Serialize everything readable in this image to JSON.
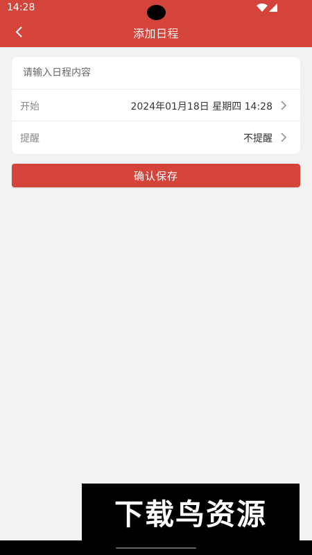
{
  "status_bar": {
    "time": "14:28",
    "icons": [
      "wifi-icon",
      "signal-icon"
    ]
  },
  "header": {
    "title": "添加日程",
    "back_icon": "chevron-left-icon",
    "bg_color": "#d4443a"
  },
  "form": {
    "content_placeholder": "请输入日程内容",
    "content_value": "",
    "start": {
      "label": "开始",
      "value": "2024年01月18日 星期四  14:28"
    },
    "reminder": {
      "label": "提醒",
      "value": "不提醒"
    },
    "row_icon": "chevron-right-icon"
  },
  "save_button": {
    "label": "确认保存",
    "color": "#d4443a"
  },
  "watermark": {
    "text": "下载鸟资源"
  }
}
